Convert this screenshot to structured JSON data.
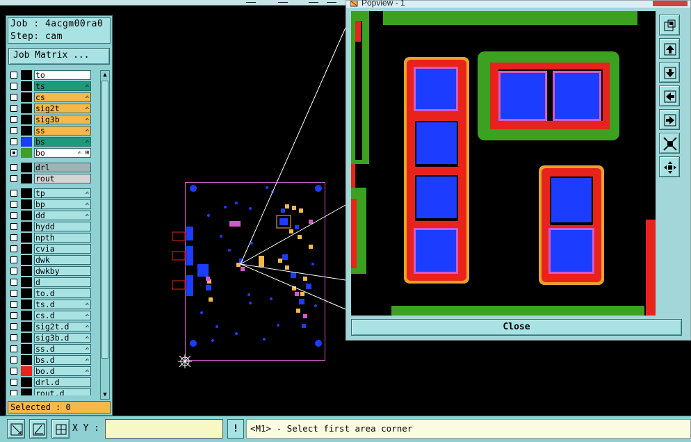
{
  "job": {
    "job_line": "Job : 4acgm00ra0",
    "step_line": "Step: cam",
    "matrix_button": "Job Matrix ..."
  },
  "layers": [
    {
      "name": "to",
      "color": "#ffffff",
      "swatch": "#000000",
      "checked": false,
      "glyph": ""
    },
    {
      "name": "ts",
      "color": "#1e9a7a",
      "swatch": "#000000",
      "checked": false,
      "glyph": "✍"
    },
    {
      "name": "cs",
      "color": "#f4b94a",
      "swatch": "#000000",
      "checked": false,
      "glyph": "✍"
    },
    {
      "name": "sig2t",
      "color": "#f4b94a",
      "swatch": "#000000",
      "checked": false,
      "glyph": "✍"
    },
    {
      "name": "sig3b",
      "color": "#f4b94a",
      "swatch": "#000000",
      "checked": false,
      "glyph": "✍"
    },
    {
      "name": "ss",
      "color": "#f4b94a",
      "swatch": "#000000",
      "checked": false,
      "glyph": "✍"
    },
    {
      "name": "bs",
      "color": "#1e9a7a",
      "swatch": "#1c3cff",
      "checked": false,
      "glyph": "✍"
    },
    {
      "name": "bo",
      "color": "#ffffff",
      "swatch": "#3ca021",
      "checked": true,
      "glyph": "✍ ⊞"
    },
    {
      "name": "drl",
      "color": "#9fb3b5",
      "swatch": "#000000",
      "checked": false,
      "glyph": ""
    },
    {
      "name": "rout",
      "color": "#d4d4d4",
      "swatch": "#000000",
      "checked": false,
      "glyph": ""
    },
    {
      "name": "tp",
      "color": "#a8e2e3",
      "swatch": "#000000",
      "checked": false,
      "glyph": "✍"
    },
    {
      "name": "bp",
      "color": "#a8e2e3",
      "swatch": "#000000",
      "checked": false,
      "glyph": "✍"
    },
    {
      "name": "dd",
      "color": "#a8e2e3",
      "swatch": "#000000",
      "checked": false,
      "glyph": "✍"
    },
    {
      "name": "hydd",
      "color": "#a8e2e3",
      "swatch": "#000000",
      "checked": false,
      "glyph": ""
    },
    {
      "name": "npth",
      "color": "#a8e2e3",
      "swatch": "#000000",
      "checked": false,
      "glyph": ""
    },
    {
      "name": "cvia",
      "color": "#a8e2e3",
      "swatch": "#000000",
      "checked": false,
      "glyph": ""
    },
    {
      "name": "dwk",
      "color": "#a8e2e3",
      "swatch": "#000000",
      "checked": false,
      "glyph": ""
    },
    {
      "name": "dwkby",
      "color": "#a8e2e3",
      "swatch": "#000000",
      "checked": false,
      "glyph": ""
    },
    {
      "name": "d",
      "color": "#a8e2e3",
      "swatch": "#000000",
      "checked": false,
      "glyph": ""
    },
    {
      "name": "to.d",
      "color": "#a8e2e3",
      "swatch": "#000000",
      "checked": false,
      "glyph": ""
    },
    {
      "name": "ts.d",
      "color": "#a8e2e3",
      "swatch": "#000000",
      "checked": false,
      "glyph": "✍"
    },
    {
      "name": "cs.d",
      "color": "#a8e2e3",
      "swatch": "#000000",
      "checked": false,
      "glyph": "✍"
    },
    {
      "name": "sig2t.d",
      "color": "#a8e2e3",
      "swatch": "#000000",
      "checked": false,
      "glyph": "✍"
    },
    {
      "name": "sig3b.d",
      "color": "#a8e2e3",
      "swatch": "#000000",
      "checked": false,
      "glyph": "✍"
    },
    {
      "name": "ss.d",
      "color": "#a8e2e3",
      "swatch": "#000000",
      "checked": false,
      "glyph": "✍"
    },
    {
      "name": "bs.d",
      "color": "#a8e2e3",
      "swatch": "#000000",
      "checked": false,
      "glyph": "✍"
    },
    {
      "name": "bo.d",
      "color": "#a8e2e3",
      "swatch": "#e8231c",
      "checked": false,
      "glyph": "✍"
    },
    {
      "name": "drl.d",
      "color": "#a8e2e3",
      "swatch": "#000000",
      "checked": false,
      "glyph": ""
    },
    {
      "name": "rout.d",
      "color": "#a8e2e3",
      "swatch": "#000000",
      "checked": false,
      "glyph": ""
    }
  ],
  "selected_label": "Selected : 0",
  "popview": {
    "title": "Popview - 1",
    "close_label": "Close"
  },
  "status": {
    "xy_label": "X Y :",
    "xy_value": "",
    "bang": "!",
    "message": "<M1> - Select first area corner"
  }
}
